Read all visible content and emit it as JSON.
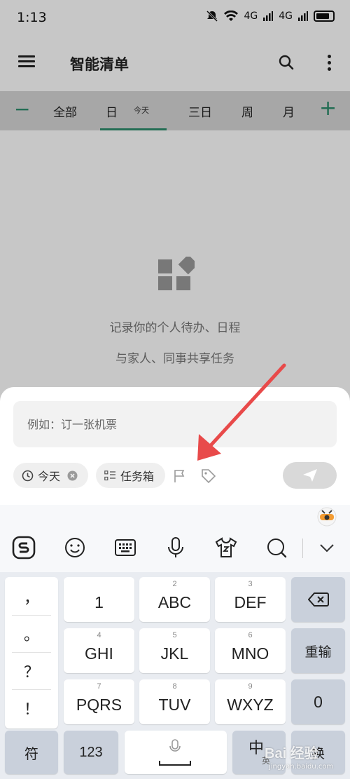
{
  "status_bar": {
    "time": "1:13",
    "signal_1": "4G",
    "signal_2": "4G"
  },
  "header": {
    "title": "智能清单",
    "menu_icon": "hamburger-menu-icon",
    "search_icon": "search-icon",
    "more_icon": "more-vertical-icon"
  },
  "tabs": {
    "minus": "−",
    "plus": "+",
    "all": "全部",
    "day": "日",
    "day_note": "今天",
    "three_day": "三日",
    "week": "周",
    "month": "月"
  },
  "empty_state": {
    "icon": "widgets-icon",
    "line1": "记录你的个人待办、日程",
    "line2": "与家人、同事共享任务"
  },
  "input_sheet": {
    "placeholder": "例如：订一张机票",
    "today_chip": "今天",
    "box_chip": "任务箱",
    "flag_icon": "flag-icon",
    "tag_icon": "tag-icon",
    "send_icon": "send-icon"
  },
  "annotation": {
    "arrow_color": "#e84a4a"
  },
  "keyboard": {
    "toolbar_icons": [
      "sogou-logo-icon",
      "emoji-icon",
      "keyboard-icon",
      "microphone-icon",
      "tshirt-skin-icon",
      "search-icon",
      "collapse-chevron-icon"
    ],
    "punctuation": [
      "，",
      "。",
      "？",
      "！"
    ],
    "keys": [
      {
        "num": "",
        "label": "1"
      },
      {
        "num": "2",
        "label": "ABC"
      },
      {
        "num": "3",
        "label": "DEF"
      },
      {
        "num": "4",
        "label": "GHI"
      },
      {
        "num": "5",
        "label": "JKL"
      },
      {
        "num": "6",
        "label": "MNO"
      },
      {
        "num": "7",
        "label": "PQRS"
      },
      {
        "num": "8",
        "label": "TUV"
      },
      {
        "num": "9",
        "label": "WXYZ"
      }
    ],
    "delete_icon": "backspace-icon",
    "retype": "重输",
    "zero": "0",
    "symbol": "符",
    "num123": "123",
    "chinese": "中",
    "chinese_sub": "英",
    "enter_partial": "换"
  },
  "watermark": {
    "brand": "Bai 经验",
    "url": "jingyan.baidu.com"
  }
}
